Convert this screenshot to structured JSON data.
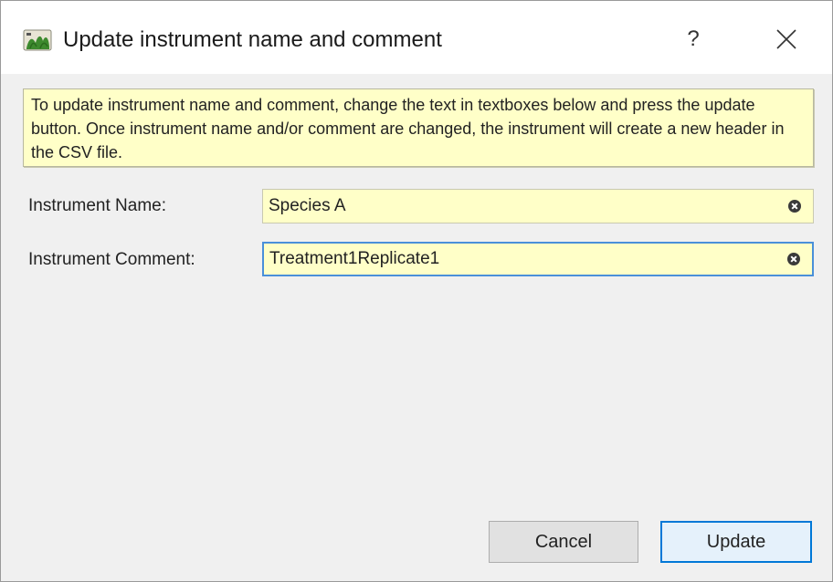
{
  "window": {
    "title": "Update instrument name and comment",
    "help_glyph": "?",
    "icon": "app-logo-icon",
    "close_icon": "close-icon"
  },
  "info": {
    "text": "To update instrument name and comment, change the text in textboxes below and press the update button. Once instrument name and/or comment are changed, the instrument will create a new header in the CSV file."
  },
  "form": {
    "name_label": "Instrument Name:",
    "name_value": "Species A",
    "comment_label": "Instrument Comment:",
    "comment_value": "Treatment1Replicate1",
    "clear_icon": "clear-icon"
  },
  "buttons": {
    "cancel": "Cancel",
    "update": "Update"
  },
  "colors": {
    "field_background": "#ffffc8",
    "focus_border": "#4a90d9",
    "default_button_border": "#0078d7"
  }
}
